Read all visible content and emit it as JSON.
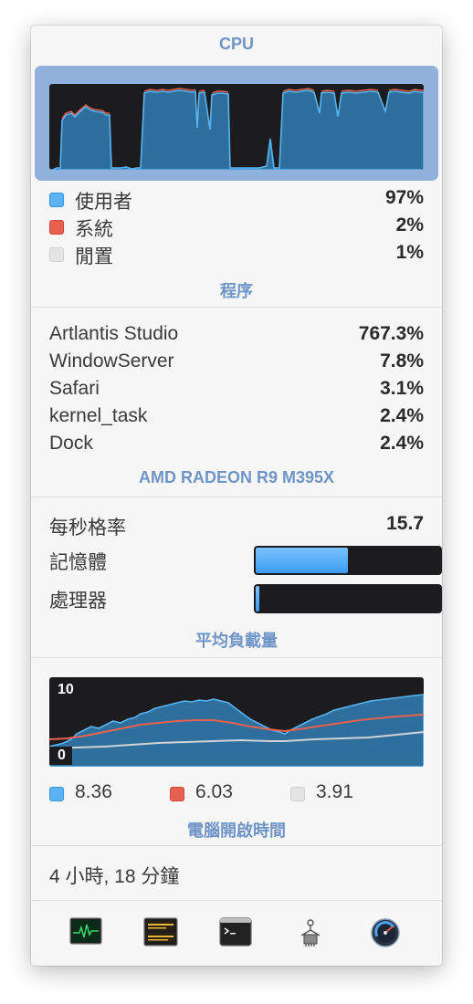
{
  "sections": {
    "cpu": "CPU",
    "processes": "程序",
    "gpu": "AMD RADEON R9 M395X",
    "load": "平均負載量",
    "uptime": "電腦開啟時間"
  },
  "cpu": {
    "user_label": "使用者",
    "user_value": "97%",
    "user_color": "#5ab3f5",
    "system_label": "系統",
    "system_value": "2%",
    "system_color": "#e8604e",
    "idle_label": "閒置",
    "idle_value": "1%",
    "idle_color": "#e4e4e4"
  },
  "processes": [
    {
      "name": "Artlantis Studio",
      "value": "767.3%"
    },
    {
      "name": "WindowServer",
      "value": "7.8%"
    },
    {
      "name": "Safari",
      "value": "3.1%"
    },
    {
      "name": "kernel_task",
      "value": "2.4%"
    },
    {
      "name": "Dock",
      "value": "2.4%"
    }
  ],
  "gpu": {
    "fps_label": "每秒格率",
    "fps_value": "15.7",
    "memory_label": "記憶體",
    "memory_level": 0.5,
    "processor_label": "處理器",
    "processor_level": 0.03
  },
  "load": {
    "scale_max": "10",
    "scale_min": "0",
    "avg1": "8.36",
    "avg1_color": "#5ab3f5",
    "avg5": "6.03",
    "avg5_color": "#e8604e",
    "avg15": "3.91",
    "avg15_color": "#e4e4e4"
  },
  "uptime": {
    "value": "4 小時, 18 分鐘"
  },
  "toolbar": [
    {
      "name": "activity-monitor-icon"
    },
    {
      "name": "console-icon"
    },
    {
      "name": "terminal-icon"
    },
    {
      "name": "system-information-icon"
    },
    {
      "name": "disk-utility-icon"
    }
  ]
}
